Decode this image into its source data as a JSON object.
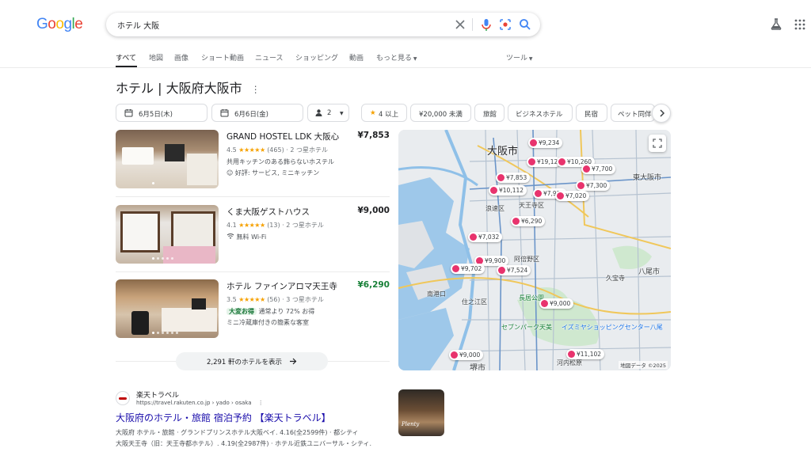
{
  "header": {
    "logo": [
      "G",
      "o",
      "o",
      "g",
      "l",
      "e"
    ],
    "logo_colors": [
      "#4285f4",
      "#ea4335",
      "#fbbc05",
      "#4285f4",
      "#34a853",
      "#ea4335"
    ],
    "query": "ホテル 大阪"
  },
  "tabs": {
    "items": [
      "すべて",
      "地図",
      "画像",
      "ショート動画",
      "ニュース",
      "ショッピング",
      "動画",
      "もっと見る"
    ],
    "tools": "ツール"
  },
  "hotels_panel": {
    "title": "ホテル | 大阪府大阪市",
    "filters": {
      "checkin": "6月5日(木)",
      "checkout": "6月6日(金)",
      "guests": "2",
      "chips": [
        "4 以上",
        "¥20,000 未満",
        "旅館",
        "ビジネスホテル",
        "民宿",
        "ペット同伴"
      ]
    },
    "hotels": [
      {
        "name": "GRAND HOSTEL LDK 大阪心",
        "price": "¥7,853",
        "rating": "4.5",
        "stars": "★★★★★",
        "reviews": "(465) · 2 つ星ホテル",
        "line3": "共用キッチンのある飾らないホステル",
        "line4": "好評: サービス, ミニキッチン",
        "price_color": "#202124"
      },
      {
        "name": "くま大阪ゲストハウス",
        "price": "¥9,000",
        "rating": "4.1",
        "stars": "★★★★★",
        "reviews": "(13) · 2 つ星ホテル",
        "line3": "無料 Wi-Fi",
        "line4": "",
        "price_color": "#202124"
      },
      {
        "name": "ホテル ファインアロマ天王寺",
        "price": "¥6,290",
        "rating": "3.5",
        "stars": "★★★★★",
        "reviews": "(56) · 3 つ星ホテル",
        "deal_badge": "大変お得",
        "deal_text": "通常より 72% お得",
        "line4": "ミニ冷蔵庫付きの簡素な客室",
        "price_color": "#188038"
      }
    ],
    "more_button": "2,291 軒のホテルを表示"
  },
  "map": {
    "labels": [
      "大阪市",
      "東大阪市",
      "八尾市",
      "天王寺区",
      "浪速区",
      "阿倍野区",
      "住之江区",
      "堺市",
      "久宝寺",
      "南港口",
      "長居公園",
      "セブンパーク天美",
      "イズミヤショッピングセンター八尾",
      "河内松原"
    ],
    "pins": [
      "¥9,234",
      "¥7,853",
      "¥10,112",
      "¥19,12",
      "¥10,260",
      "¥7,700",
      "¥7,300",
      "¥7,920",
      "¥7,020",
      "¥6,290",
      "¥7,032",
      "¥9,900",
      "¥9,702",
      "¥7,524",
      "¥9,000",
      "¥9,000",
      "¥11,102"
    ],
    "attribution": "地図データ ©2025"
  },
  "result": {
    "site": "楽天トラベル",
    "url": "https://travel.rakuten.co.jp › yado › osaka",
    "title": "大阪府のホテル・旅館 宿泊予約 【楽天トラベル】",
    "snippet1": "大阪府 ホテル・旅館 · グランドプリンスホテル大阪ベイ. 4.16(全2599件) · 都シティ",
    "snippet2": "大阪天王寺（旧：天王寺都ホテル）. 4.19(全2987件) · ホテル近鉄ユニバーサル・シティ.",
    "thumb_text": "Plenty"
  }
}
